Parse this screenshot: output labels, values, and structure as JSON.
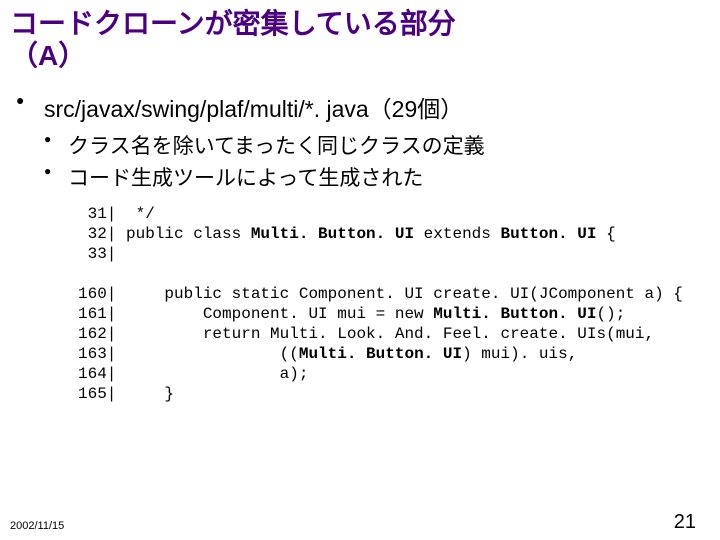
{
  "title_line1": "コードクローンが密集している部分",
  "title_line2": "（A）",
  "main_bullet": "src/javax/swing/plaf/multi/*. java（29個）",
  "sub": {
    "a": "クラス名を除いてまったく同じクラスの定義",
    "b": "コード生成ツールによって生成された"
  },
  "code": {
    "l31_num": " 31|",
    "l31_txt": "  */",
    "l32_num": " 32|",
    "l32_pre": " public class ",
    "l32_b1": "Multi. Button. UI",
    "l32_mid": " extends ",
    "l32_b2": "Button. UI",
    "l32_post": " {",
    "l33_num": " 33|",
    "l160_num": "160|",
    "l160_txt": "     public static Component. UI create. UI(JComponent a) {",
    "l161_num": "161|",
    "l161_pre": "         Component. UI mui = new ",
    "l161_b": "Multi. Button. UI",
    "l161_post": "();",
    "l162_num": "162|",
    "l162_txt": "         return Multi. Look. And. Feel. create. UIs(mui,",
    "l163_num": "163|",
    "l163_pre": "                 ((",
    "l163_b": "Multi. Button. UI",
    "l163_post": ") mui). uis,",
    "l164_num": "164|",
    "l164_txt": "                 a);",
    "l165_num": "165|",
    "l165_txt": "     }"
  },
  "footer": {
    "date": "2002/11/15",
    "page": "21"
  }
}
